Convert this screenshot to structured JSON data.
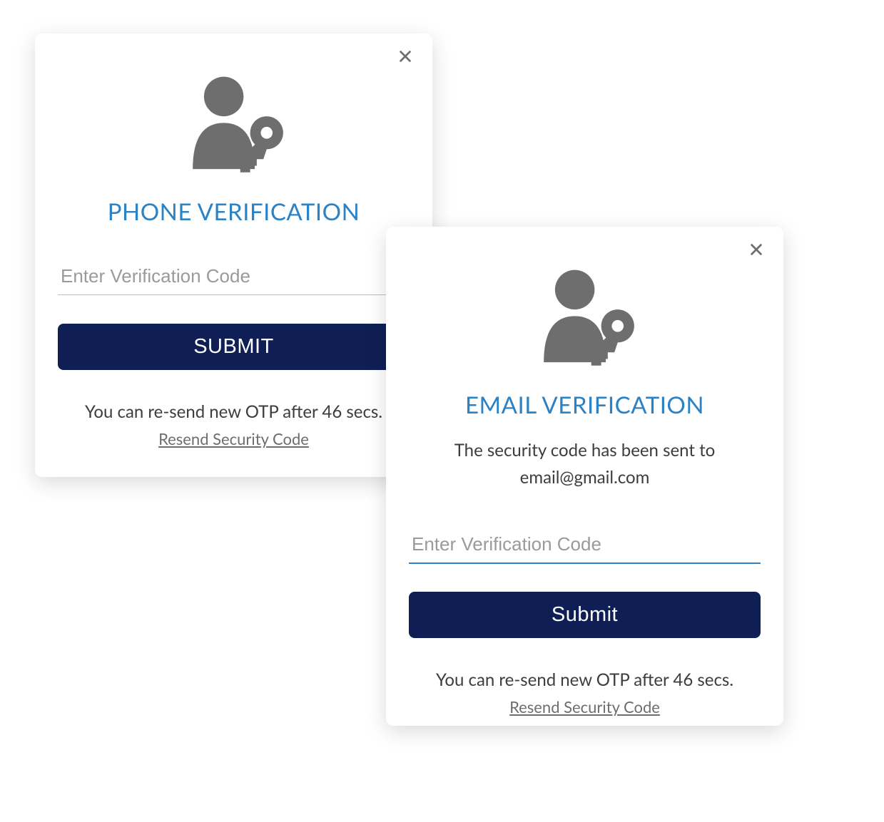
{
  "colors": {
    "accent": "#2b82c4",
    "buttonBg": "#0f1f56",
    "buttonText": "#ffffff",
    "textMuted": "#6e6e6e",
    "textBody": "#3d3d3d"
  },
  "phoneModal": {
    "title": "PHONE VERIFICATION",
    "input": {
      "placeholder": "Enter Verification Code",
      "value": ""
    },
    "submitLabel": "SUBMIT",
    "resendMessage": "You can re-send new OTP after 46 secs.",
    "resendLink": "Resend Security Code"
  },
  "emailModal": {
    "title": "EMAIL VERIFICATION",
    "subtitle": "The security code has been sent to email@gmail.com",
    "input": {
      "placeholder": "Enter Verification Code",
      "value": ""
    },
    "submitLabel": "Submit",
    "resendMessage": "You can re-send new OTP after 46 secs.",
    "resendLink": "Resend Security Code"
  }
}
